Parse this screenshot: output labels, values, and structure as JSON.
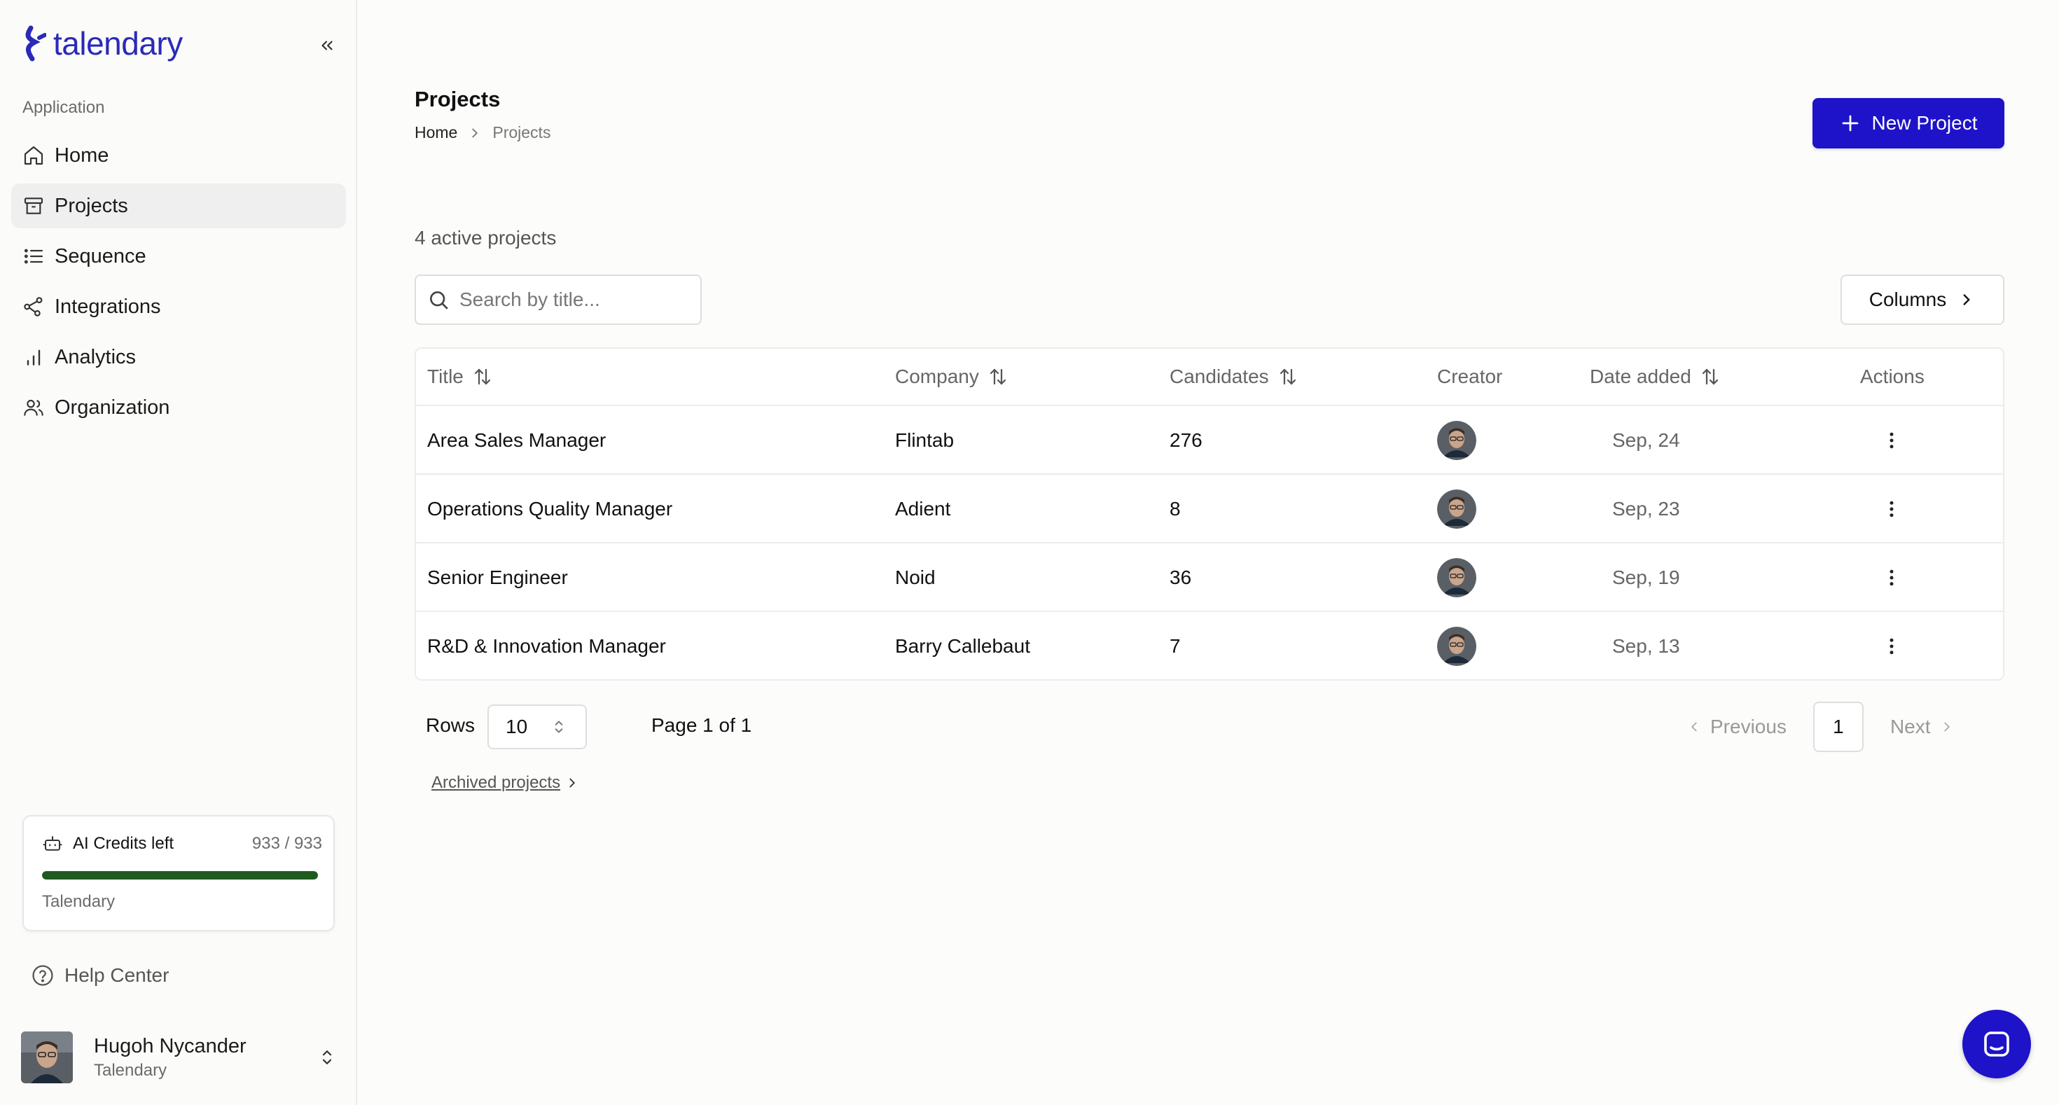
{
  "app": {
    "logo_text": "talendary"
  },
  "sidebar": {
    "section_label": "Application",
    "items": [
      {
        "label": "Home",
        "icon": "home-icon"
      },
      {
        "label": "Projects",
        "icon": "archive-box-icon",
        "active": true
      },
      {
        "label": "Sequence",
        "icon": "list-icon"
      },
      {
        "label": "Integrations",
        "icon": "share-nodes-icon"
      },
      {
        "label": "Analytics",
        "icon": "bar-chart-icon"
      },
      {
        "label": "Organization",
        "icon": "users-icon"
      }
    ],
    "credits": {
      "label": "AI Credits left",
      "value": "933 / 933",
      "fraction": 1.0,
      "org": "Talendary",
      "bar_color": "#1f5a1f"
    },
    "help_label": "Help Center",
    "user": {
      "name": "Hugoh Nycander",
      "org": "Talendary"
    }
  },
  "header": {
    "title": "Projects",
    "breadcrumb": [
      "Home",
      "Projects"
    ],
    "new_button": "New Project",
    "accent_color": "#1e13c8"
  },
  "main": {
    "active_count": "4 active projects",
    "search_placeholder": "Search by title...",
    "columns_button": "Columns",
    "table": {
      "headers": [
        "Title",
        "Company",
        "Candidates",
        "Creator",
        "Date added",
        "Actions"
      ],
      "rows": [
        {
          "title": "Area Sales Manager",
          "company": "Flintab",
          "candidates": "276",
          "date": "Sep, 24"
        },
        {
          "title": "Operations Quality Manager",
          "company": "Adient",
          "candidates": "8",
          "date": "Sep, 23"
        },
        {
          "title": "Senior Engineer",
          "company": "Noid",
          "candidates": "36",
          "date": "Sep, 19"
        },
        {
          "title": "R&D & Innovation Manager",
          "company": "Barry Callebaut",
          "candidates": "7",
          "date": "Sep, 13"
        }
      ]
    },
    "pagination": {
      "rows_label": "Rows",
      "rows_value": "10",
      "page_info": "Page 1 of 1",
      "previous": "Previous",
      "current_page": "1",
      "next": "Next"
    },
    "archived_link": "Archived projects"
  }
}
